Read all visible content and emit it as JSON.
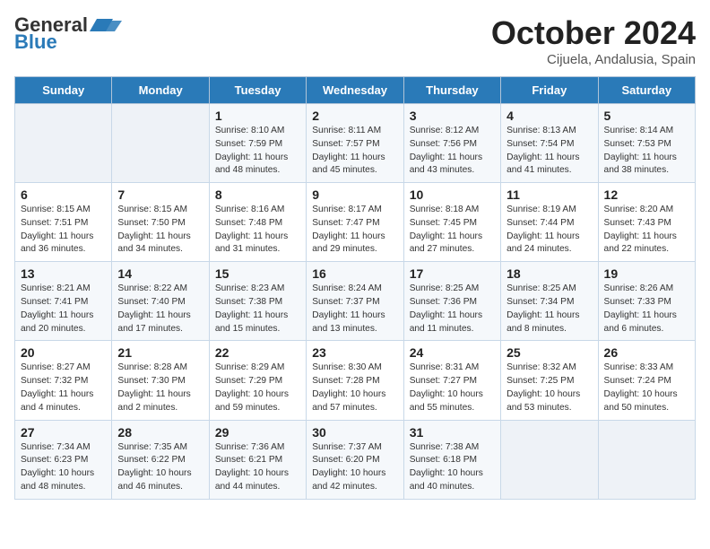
{
  "header": {
    "logo_line1": "General",
    "logo_line2": "Blue",
    "month": "October 2024",
    "location": "Cijuela, Andalusia, Spain"
  },
  "days_of_week": [
    "Sunday",
    "Monday",
    "Tuesday",
    "Wednesday",
    "Thursday",
    "Friday",
    "Saturday"
  ],
  "weeks": [
    [
      {
        "num": "",
        "info": ""
      },
      {
        "num": "",
        "info": ""
      },
      {
        "num": "1",
        "info": "Sunrise: 8:10 AM\nSunset: 7:59 PM\nDaylight: 11 hours and 48 minutes."
      },
      {
        "num": "2",
        "info": "Sunrise: 8:11 AM\nSunset: 7:57 PM\nDaylight: 11 hours and 45 minutes."
      },
      {
        "num": "3",
        "info": "Sunrise: 8:12 AM\nSunset: 7:56 PM\nDaylight: 11 hours and 43 minutes."
      },
      {
        "num": "4",
        "info": "Sunrise: 8:13 AM\nSunset: 7:54 PM\nDaylight: 11 hours and 41 minutes."
      },
      {
        "num": "5",
        "info": "Sunrise: 8:14 AM\nSunset: 7:53 PM\nDaylight: 11 hours and 38 minutes."
      }
    ],
    [
      {
        "num": "6",
        "info": "Sunrise: 8:15 AM\nSunset: 7:51 PM\nDaylight: 11 hours and 36 minutes."
      },
      {
        "num": "7",
        "info": "Sunrise: 8:15 AM\nSunset: 7:50 PM\nDaylight: 11 hours and 34 minutes."
      },
      {
        "num": "8",
        "info": "Sunrise: 8:16 AM\nSunset: 7:48 PM\nDaylight: 11 hours and 31 minutes."
      },
      {
        "num": "9",
        "info": "Sunrise: 8:17 AM\nSunset: 7:47 PM\nDaylight: 11 hours and 29 minutes."
      },
      {
        "num": "10",
        "info": "Sunrise: 8:18 AM\nSunset: 7:45 PM\nDaylight: 11 hours and 27 minutes."
      },
      {
        "num": "11",
        "info": "Sunrise: 8:19 AM\nSunset: 7:44 PM\nDaylight: 11 hours and 24 minutes."
      },
      {
        "num": "12",
        "info": "Sunrise: 8:20 AM\nSunset: 7:43 PM\nDaylight: 11 hours and 22 minutes."
      }
    ],
    [
      {
        "num": "13",
        "info": "Sunrise: 8:21 AM\nSunset: 7:41 PM\nDaylight: 11 hours and 20 minutes."
      },
      {
        "num": "14",
        "info": "Sunrise: 8:22 AM\nSunset: 7:40 PM\nDaylight: 11 hours and 17 minutes."
      },
      {
        "num": "15",
        "info": "Sunrise: 8:23 AM\nSunset: 7:38 PM\nDaylight: 11 hours and 15 minutes."
      },
      {
        "num": "16",
        "info": "Sunrise: 8:24 AM\nSunset: 7:37 PM\nDaylight: 11 hours and 13 minutes."
      },
      {
        "num": "17",
        "info": "Sunrise: 8:25 AM\nSunset: 7:36 PM\nDaylight: 11 hours and 11 minutes."
      },
      {
        "num": "18",
        "info": "Sunrise: 8:25 AM\nSunset: 7:34 PM\nDaylight: 11 hours and 8 minutes."
      },
      {
        "num": "19",
        "info": "Sunrise: 8:26 AM\nSunset: 7:33 PM\nDaylight: 11 hours and 6 minutes."
      }
    ],
    [
      {
        "num": "20",
        "info": "Sunrise: 8:27 AM\nSunset: 7:32 PM\nDaylight: 11 hours and 4 minutes."
      },
      {
        "num": "21",
        "info": "Sunrise: 8:28 AM\nSunset: 7:30 PM\nDaylight: 11 hours and 2 minutes."
      },
      {
        "num": "22",
        "info": "Sunrise: 8:29 AM\nSunset: 7:29 PM\nDaylight: 10 hours and 59 minutes."
      },
      {
        "num": "23",
        "info": "Sunrise: 8:30 AM\nSunset: 7:28 PM\nDaylight: 10 hours and 57 minutes."
      },
      {
        "num": "24",
        "info": "Sunrise: 8:31 AM\nSunset: 7:27 PM\nDaylight: 10 hours and 55 minutes."
      },
      {
        "num": "25",
        "info": "Sunrise: 8:32 AM\nSunset: 7:25 PM\nDaylight: 10 hours and 53 minutes."
      },
      {
        "num": "26",
        "info": "Sunrise: 8:33 AM\nSunset: 7:24 PM\nDaylight: 10 hours and 50 minutes."
      }
    ],
    [
      {
        "num": "27",
        "info": "Sunrise: 7:34 AM\nSunset: 6:23 PM\nDaylight: 10 hours and 48 minutes."
      },
      {
        "num": "28",
        "info": "Sunrise: 7:35 AM\nSunset: 6:22 PM\nDaylight: 10 hours and 46 minutes."
      },
      {
        "num": "29",
        "info": "Sunrise: 7:36 AM\nSunset: 6:21 PM\nDaylight: 10 hours and 44 minutes."
      },
      {
        "num": "30",
        "info": "Sunrise: 7:37 AM\nSunset: 6:20 PM\nDaylight: 10 hours and 42 minutes."
      },
      {
        "num": "31",
        "info": "Sunrise: 7:38 AM\nSunset: 6:18 PM\nDaylight: 10 hours and 40 minutes."
      },
      {
        "num": "",
        "info": ""
      },
      {
        "num": "",
        "info": ""
      }
    ]
  ]
}
